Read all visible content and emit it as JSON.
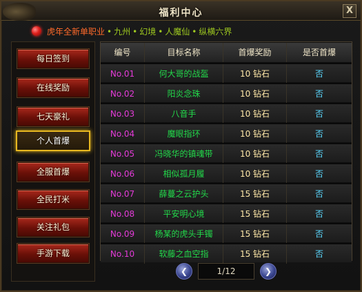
{
  "window": {
    "title": "福利中心",
    "close_label": "X"
  },
  "server": {
    "prefix": "虎年全新单职业",
    "separator": "•",
    "names": [
      "九州",
      "幻境",
      "人魔仙",
      "纵横六界"
    ]
  },
  "sidebar": {
    "items": [
      {
        "label": "每日签到",
        "active": false
      },
      {
        "label": "在线奖励",
        "active": false
      },
      {
        "label": "七天豪礼",
        "active": false
      },
      {
        "label": "个人首爆",
        "active": true
      },
      {
        "label": "全服首爆",
        "active": false
      },
      {
        "label": "全民打米",
        "active": false
      },
      {
        "label": "关注礼包",
        "active": false
      },
      {
        "label": "手游下载",
        "active": false
      }
    ]
  },
  "table": {
    "headers": [
      "编号",
      "目标名称",
      "首爆奖励",
      "是否首爆"
    ],
    "rows": [
      {
        "id": "No.01",
        "name": "何大哥的战盔",
        "reward": "10 钻石",
        "status": "否"
      },
      {
        "id": "No.02",
        "name": "阳炎念珠",
        "reward": "10 钻石",
        "status": "否"
      },
      {
        "id": "No.03",
        "name": "八音手",
        "reward": "10 钻石",
        "status": "否"
      },
      {
        "id": "No.04",
        "name": "魔眼指环",
        "reward": "10 钻石",
        "status": "否"
      },
      {
        "id": "No.05",
        "name": "冯晓华的镇魂带",
        "reward": "10 钻石",
        "status": "否"
      },
      {
        "id": "No.06",
        "name": "相似孤月履",
        "reward": "10 钻石",
        "status": "否"
      },
      {
        "id": "No.07",
        "name": "薛蔓之云护头",
        "reward": "15 钻石",
        "status": "否"
      },
      {
        "id": "No.08",
        "name": "平安明心境",
        "reward": "15 钻石",
        "status": "否"
      },
      {
        "id": "No.09",
        "name": "杨某的虎头手镯",
        "reward": "15 钻石",
        "status": "否"
      },
      {
        "id": "No.10",
        "name": "软藤之血空指",
        "reward": "15 钻石",
        "status": "否"
      }
    ]
  },
  "pager": {
    "page_text": "1/12",
    "prev_icon": "left-arrow-icon",
    "next_icon": "right-arrow-icon"
  }
}
